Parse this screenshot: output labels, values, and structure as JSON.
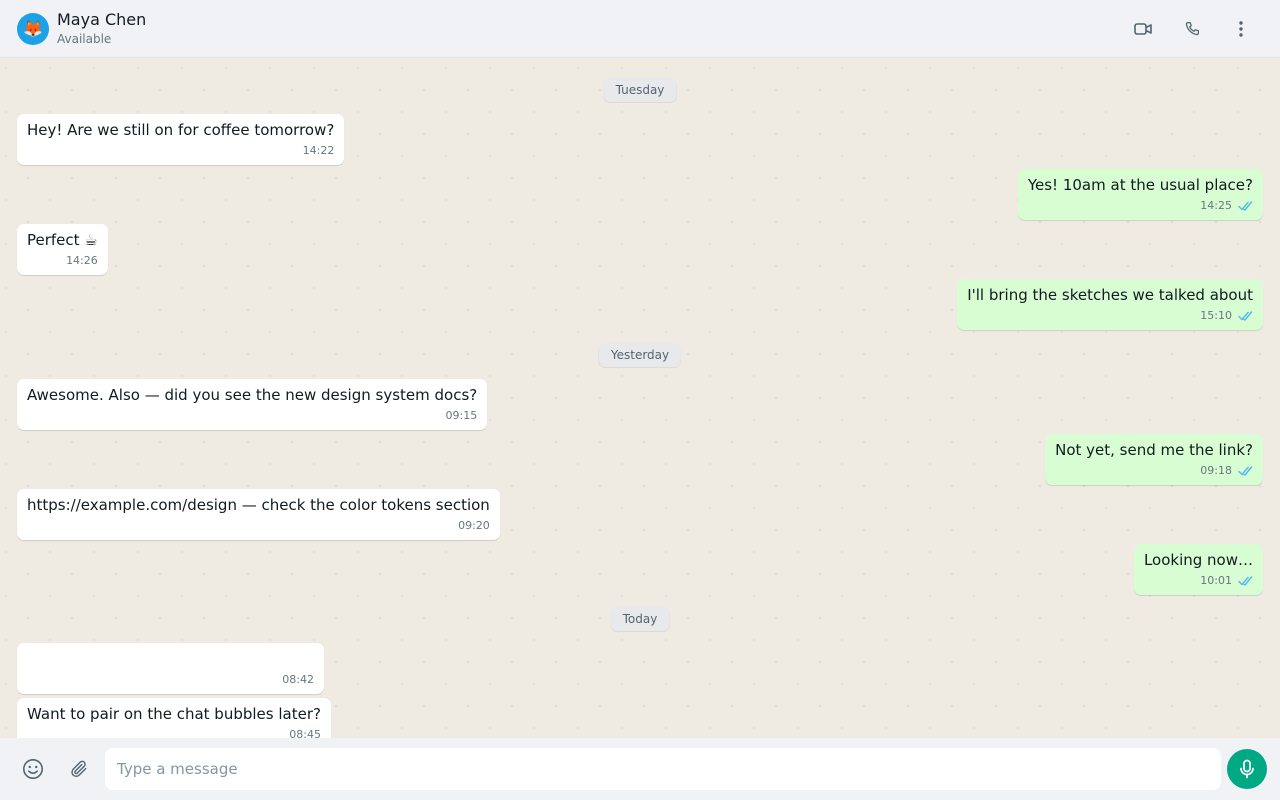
{
  "colors": {
    "accent": "#00a884",
    "incoming_bubble": "#ffffff",
    "outgoing_bubble": "#d9fdd3",
    "read_ticks": "#53bdeb",
    "avatar_bg": "#1da1e6"
  },
  "header": {
    "avatar_icon": "fox-emoji",
    "avatar_glyph": "🦊",
    "contact_name": "Maya Chen",
    "contact_status": "Available",
    "actions": [
      "video-call-icon",
      "voice-call-icon",
      "more-options-icon"
    ]
  },
  "chat": {
    "date_separators": {
      "tuesday": "Tuesday",
      "yesterday": "Yesterday",
      "today": "Today"
    },
    "messages": [
      {
        "direction": "in",
        "text": "Hey! Are we still on for coffee tomorrow?",
        "time": "14:22"
      },
      {
        "direction": "out",
        "text": "Yes! 10am at the usual place?",
        "time": "14:25",
        "status": "read"
      },
      {
        "direction": "in",
        "text": "Perfect ☕",
        "time": "14:26"
      },
      {
        "direction": "out",
        "text": "I'll bring the sketches we talked about",
        "time": "15:10",
        "status": "read"
      },
      {
        "direction": "in",
        "text": "Awesome. Also — did you see the new design system docs?",
        "time": "09:15"
      },
      {
        "direction": "out",
        "text": "Not yet, send me the link?",
        "time": "09:18",
        "status": "read"
      },
      {
        "direction": "in",
        "text": "https://example.com/design — check the color tokens section",
        "time": "09:20"
      },
      {
        "direction": "out",
        "text": "Looking now…",
        "time": "10:01",
        "status": "read"
      },
      {
        "direction": "in",
        "text": "",
        "time": "08:42"
      },
      {
        "direction": "in",
        "text": "Want to pair on the chat bubbles later?",
        "time": "08:45"
      }
    ]
  },
  "composer": {
    "emoji_icon": "emoji-icon",
    "attach_icon": "paperclip-icon",
    "input_placeholder": "Type a message",
    "input_value": "",
    "mic_icon": "microphone-icon"
  }
}
